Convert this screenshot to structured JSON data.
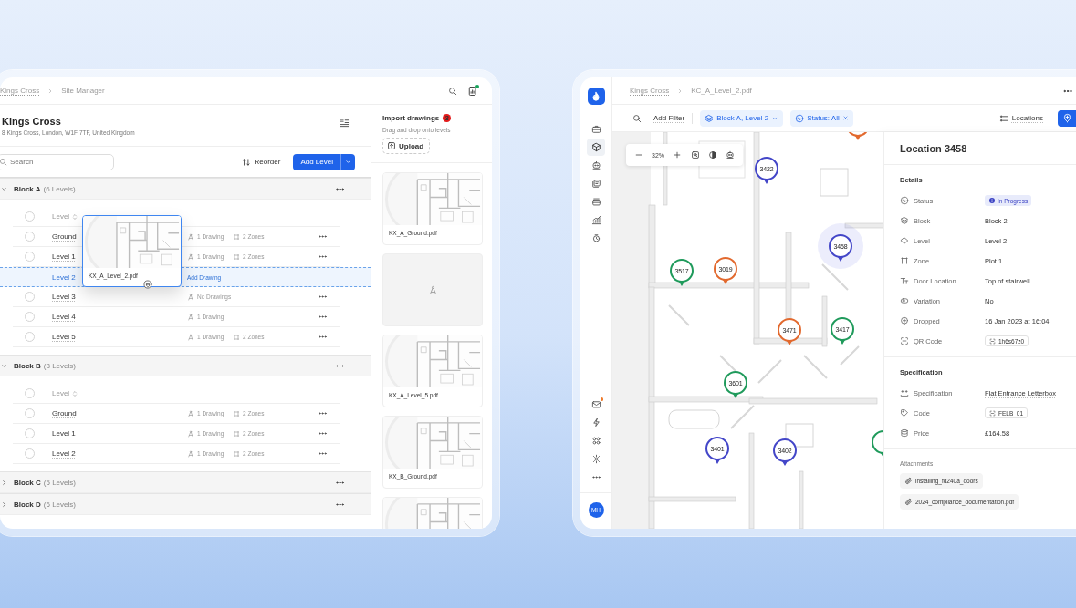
{
  "left_window": {
    "breadcrumb": [
      "Kings Cross",
      "Site Manager"
    ],
    "site": {
      "name": "Kings Cross",
      "address": "8 Kings Cross, London, W1F 7TF, United Kingdom"
    },
    "search": {
      "placeholder": "Search"
    },
    "reorder_button": "Reorder",
    "add_button": "Add Level",
    "blocks": [
      {
        "name": "Block A",
        "count": "(6 Levels)",
        "expanded": true,
        "column_label": "Level",
        "all_checked": false,
        "levels": [
          {
            "kind": "level",
            "name": "Ground",
            "drawings": "1 Drawing",
            "zones": "2 Zones",
            "checked": false
          },
          {
            "kind": "level",
            "name": "Level 1",
            "drawings": "1 Drawing",
            "zones": "2 Zones",
            "checked": false
          },
          {
            "kind": "drop_target",
            "name": "Level 2",
            "action": "Add Drawing"
          },
          {
            "kind": "level",
            "name": "Level 3",
            "drawings": "No Drawings",
            "checked": false
          },
          {
            "kind": "level",
            "name": "Level 4",
            "drawings": "1 Drawing",
            "checked": false
          },
          {
            "kind": "level",
            "name": "Level 5",
            "drawings": "1 Drawing",
            "zones": "2 Zones",
            "checked": false
          }
        ]
      },
      {
        "name": "Block B",
        "count": "(3 Levels)",
        "expanded": true,
        "column_label": "Level",
        "all_checked": false,
        "levels": [
          {
            "kind": "level",
            "name": "Ground",
            "drawings": "1 Drawing",
            "zones": "2 Zones",
            "checked": false
          },
          {
            "kind": "level",
            "name": "Level 1",
            "drawings": "1 Drawing",
            "zones": "2 Zones",
            "checked": false
          },
          {
            "kind": "level",
            "name": "Level 2",
            "drawings": "1 Drawing",
            "zones": "2 Zones",
            "checked": false
          }
        ]
      },
      {
        "name": "Block C",
        "count": "(5 Levels)",
        "expanded": false
      },
      {
        "name": "Block D",
        "count": "(6 Levels)",
        "expanded": false
      }
    ],
    "drag_card": {
      "name": "KX_A_Level_2.pdf"
    },
    "import": {
      "title": "Import drawings",
      "badge": "3",
      "hint": "Drag and drop onto levels",
      "upload": "Upload",
      "files": [
        {
          "kind": "file",
          "name": "KX_A_Ground.pdf"
        },
        {
          "kind": "placeholder"
        },
        {
          "kind": "file",
          "name": "KX_A_Level_5.pdf"
        },
        {
          "kind": "file",
          "name": "KX_B_Ground.pdf"
        },
        {
          "kind": "file"
        }
      ]
    }
  },
  "right_window": {
    "breadcrumb": [
      "Kings Cross",
      "KC_A_Level_2.pdf"
    ],
    "nav_top": [
      {
        "selected": false
      },
      {
        "selected": true
      },
      {
        "selected": false
      },
      {
        "selected": false
      },
      {
        "selected": false
      },
      {
        "selected": false
      },
      {
        "selected": false
      }
    ],
    "nav_bottom": [
      {
        "dot": true
      },
      {
        "dot": false
      },
      {
        "dot": false
      },
      {
        "dot": false
      },
      {
        "dot": false
      }
    ],
    "avatar": "MH",
    "filter_bar": {
      "add_filter": "Add Filter",
      "chips": [
        {
          "kind": "dropdown",
          "label": "Block A, Level 2"
        },
        {
          "kind": "removable",
          "label": "Status: All"
        }
      ],
      "locations_button": "Locations"
    },
    "zoom": "32%",
    "pins": [
      {
        "label": "3422",
        "color": "#4346c8",
        "selected": false
      },
      {
        "label": "3458",
        "color": "#4346c8",
        "selected": true
      },
      {
        "label": "3517",
        "color": "#1f9a5b",
        "selected": false
      },
      {
        "label": "3019",
        "color": "#e2692e",
        "selected": false
      },
      {
        "label": "3471",
        "color": "#e2692e",
        "selected": false
      },
      {
        "label": "3417",
        "color": "#1f9a5b",
        "selected": false
      },
      {
        "label": "3601",
        "color": "#1f9a5b",
        "selected": false
      },
      {
        "label": "3401",
        "color": "#4346c8",
        "selected": false
      },
      {
        "label": "3402",
        "color": "#4346c8",
        "selected": false
      },
      {
        "color": "#e2692e",
        "selected": false
      },
      {
        "color": "#1f9a5b",
        "selected": false
      }
    ],
    "details": {
      "title": "Location 3458",
      "sections": [
        {
          "heading": "Details",
          "rows": [
            {
              "label": "Status",
              "kind": "badge",
              "value": "In Progress"
            },
            {
              "label": "Block",
              "kind": "text",
              "value": "Block 2"
            },
            {
              "label": "Level",
              "kind": "text",
              "value": "Level 2"
            },
            {
              "label": "Zone",
              "kind": "text",
              "value": "Plot 1"
            },
            {
              "label": "Door Location",
              "kind": "text",
              "value": "Top of stairwell"
            },
            {
              "label": "Variation",
              "kind": "text",
              "value": "No"
            },
            {
              "label": "Dropped",
              "kind": "text",
              "value": "16 Jan 2023 at 16:04"
            },
            {
              "label": "QR Code",
              "kind": "chip",
              "value": "1h6s67z0"
            }
          ]
        },
        {
          "heading": "Specification",
          "rows": [
            {
              "label": "Specification",
              "kind": "link",
              "value": "Flat Entrance Letterbox"
            },
            {
              "label": "Code",
              "kind": "chip",
              "value": "FELB_01"
            },
            {
              "label": "Price",
              "kind": "text",
              "value": "£164.58"
            }
          ]
        }
      ],
      "attachments_heading": "Attachments",
      "attachments": [
        "installing_fd240a_doors",
        "2024_compliance_documentation.pdf"
      ]
    }
  }
}
